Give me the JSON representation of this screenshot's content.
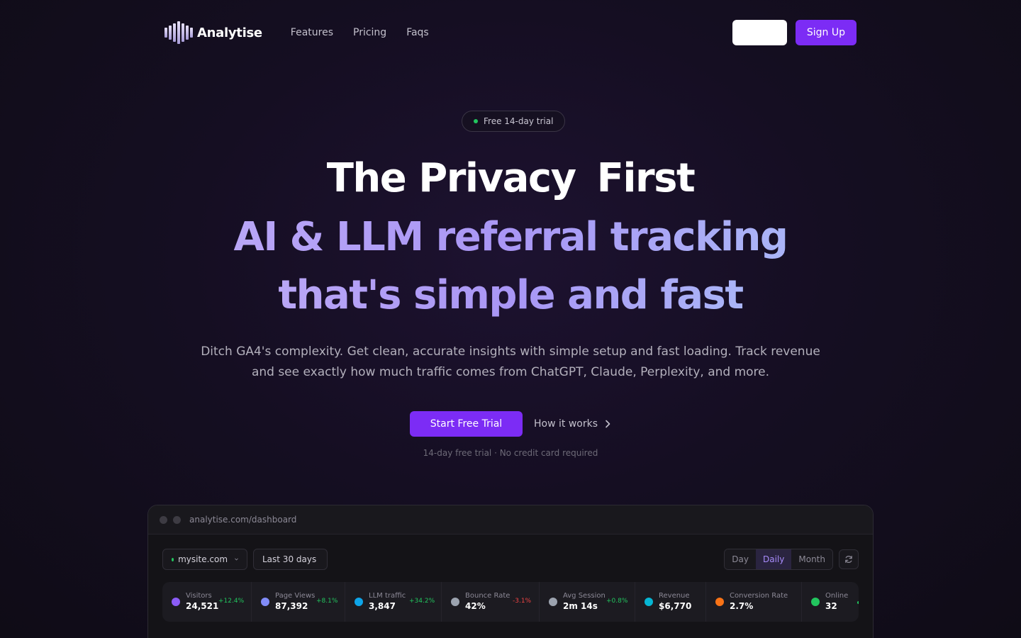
{
  "nav": {
    "logo_text": "Analytise",
    "links": [
      "Features",
      "Pricing",
      "Faqs"
    ],
    "login_label": "",
    "signup_label": "Sign Up"
  },
  "hero": {
    "badge": "Free 14-day trial",
    "headline_1a": "The Privacy",
    "headline_1b": "First",
    "headline_2": "AI & LLM referral tracking",
    "headline_3": "that's simple and fast",
    "subtitle": "Ditch GA4's complexity. Get clean, accurate insights with simple setup and fast loading. Track revenue and see exactly how much traffic comes from ChatGPT, Claude, Perplexity, and more.",
    "cta_primary": "Start Free Trial",
    "cta_secondary": "How it works",
    "note": "14-day free trial · No credit card required"
  },
  "dashboard": {
    "url": "analytise.com/dashboard",
    "site": "mysite.com",
    "range": "Last 30 days",
    "segments": [
      "Day",
      "Daily",
      "Month"
    ],
    "active_segment": "Daily",
    "metrics": [
      {
        "label": "Visitors",
        "value": "24,521",
        "change": "+12.4%",
        "trend": "up",
        "color": "#8b5cf6"
      },
      {
        "label": "Page Views",
        "value": "87,392",
        "change": "+8.1%",
        "trend": "up",
        "color": "#818cf8"
      },
      {
        "label": "LLM traffic",
        "value": "3,847",
        "change": "+34.2%",
        "trend": "up",
        "color": "#0ea5e9"
      },
      {
        "label": "Bounce Rate",
        "value": "42%",
        "change": "-3.1%",
        "trend": "down",
        "color": "#9ca3af"
      },
      {
        "label": "Avg Session",
        "value": "2m 14s",
        "change": "+0.8%",
        "trend": "up",
        "color": "#9ca3af"
      },
      {
        "label": "Revenue",
        "value": "$6,770",
        "change": "",
        "trend": "",
        "color": "#06b6d4"
      },
      {
        "label": "Conversion Rate",
        "value": "2.7%",
        "change": "",
        "trend": "",
        "color": "#f97316"
      },
      {
        "label": "Online",
        "value": "32",
        "change": "",
        "trend": "",
        "color": "#22c55e"
      }
    ]
  },
  "colors": {
    "accent": "#7c2cf5",
    "positive": "#22c55e",
    "negative": "#ef4444"
  }
}
